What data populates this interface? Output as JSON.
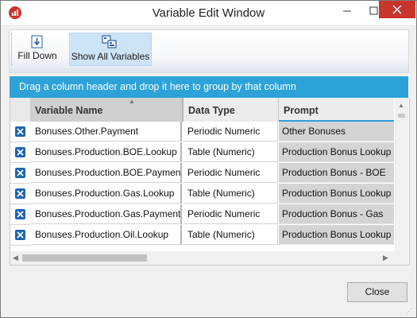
{
  "window": {
    "title": "Variable Edit Window",
    "icon": "chart-app-icon"
  },
  "titlebar_buttons": [
    "minimize",
    "maximize",
    "close"
  ],
  "toolbar": {
    "fill_down_label": "Fill Down",
    "show_all_label": "Show All Variables",
    "fill_down_icon": "fill-down-icon",
    "show_all_icon": "show-all-variables-icon",
    "show_all_active": true
  },
  "group_bar": {
    "text": "Drag a column header and drop it here to group by that column"
  },
  "grid": {
    "columns": [
      {
        "label": "Variable Name",
        "sorted": "ascending"
      },
      {
        "label": "Data Type"
      },
      {
        "label": "Prompt"
      }
    ],
    "rows": [
      {
        "name": "Bonuses.Other.Payment",
        "type": "Periodic Numeric",
        "prompt": "Other Bonuses"
      },
      {
        "name": "Bonuses.Production.BOE.Lookup",
        "type": "Table (Numeric)",
        "prompt": "Production Bonus Lookup"
      },
      {
        "name": "Bonuses.Production.BOE.Payment",
        "type": "Periodic Numeric",
        "prompt": "Production Bonus - BOE"
      },
      {
        "name": "Bonuses.Production.Gas.Lookup",
        "type": "Table (Numeric)",
        "prompt": "Production Bonus Lookup"
      },
      {
        "name": "Bonuses.Production.Gas.Payment",
        "type": "Periodic Numeric",
        "prompt": "Production Bonus - Gas"
      },
      {
        "name": "Bonuses.Production.Oil.Lookup",
        "type": "Table (Numeric)",
        "prompt": "Production Bonus Lookup"
      }
    ]
  },
  "close_button": {
    "label": "Close"
  },
  "colors": {
    "accent": "#2CA2D9",
    "close_red": "#C7352B",
    "row_icon": "#1F63B5"
  }
}
